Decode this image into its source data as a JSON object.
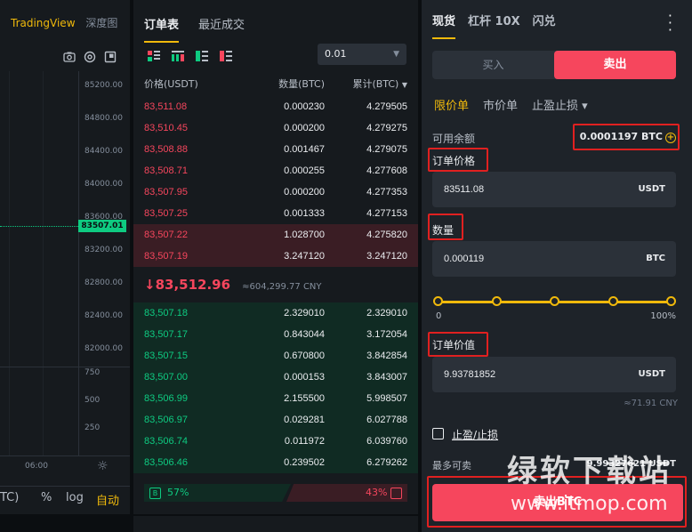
{
  "chart": {
    "tabs": [
      "TradingView",
      "深度图"
    ],
    "price_ticks": [
      "85200.00",
      "84800.00",
      "84400.00",
      "84000.00",
      "83600.00",
      "83200.00",
      "82800.00",
      "82400.00",
      "82000.00"
    ],
    "current_price": "83507.01",
    "volume_ticks": [
      "750",
      "500",
      "250"
    ],
    "time_label": "06:00",
    "bottom": {
      "unit_fragment": "TC)",
      "percent": "%",
      "log": "log",
      "auto": "自动"
    }
  },
  "book": {
    "tabs": [
      "订单表",
      "最近成交"
    ],
    "precision": "0.01",
    "headers": {
      "price": "价格(USDT)",
      "amount": "数量(BTC)",
      "total": "累计(BTC)"
    },
    "asks": [
      {
        "price": "83,511.08",
        "amount": "0.000230",
        "total": "4.279505",
        "depth": 0.0
      },
      {
        "price": "83,510.45",
        "amount": "0.000200",
        "total": "4.279275",
        "depth": 0.0
      },
      {
        "price": "83,508.88",
        "amount": "0.001467",
        "total": "4.279075",
        "depth": 0.0
      },
      {
        "price": "83,508.71",
        "amount": "0.000255",
        "total": "4.277608",
        "depth": 0.0
      },
      {
        "price": "83,507.95",
        "amount": "0.000200",
        "total": "4.277353",
        "depth": 0.0
      },
      {
        "price": "83,507.25",
        "amount": "0.001333",
        "total": "4.277153",
        "depth": 0.0
      },
      {
        "price": "83,507.22",
        "amount": "1.028700",
        "total": "4.275820",
        "depth": 1.0
      },
      {
        "price": "83,507.19",
        "amount": "3.247120",
        "total": "3.247120",
        "depth": 1.0
      }
    ],
    "mid_price": "↓83,512.96",
    "mid_cny": "≈604,299.77 CNY",
    "bids": [
      {
        "price": "83,507.18",
        "amount": "2.329010",
        "total": "2.329010",
        "depth": 1.0
      },
      {
        "price": "83,507.17",
        "amount": "0.843044",
        "total": "3.172054",
        "depth": 1.0
      },
      {
        "price": "83,507.15",
        "amount": "0.670800",
        "total": "3.842854",
        "depth": 1.0
      },
      {
        "price": "83,507.00",
        "amount": "0.000153",
        "total": "3.843007",
        "depth": 1.0
      },
      {
        "price": "83,506.99",
        "amount": "2.155500",
        "total": "5.998507",
        "depth": 1.0
      },
      {
        "price": "83,506.97",
        "amount": "0.029281",
        "total": "6.027788",
        "depth": 1.0
      },
      {
        "price": "83,506.74",
        "amount": "0.011972",
        "total": "6.039760",
        "depth": 1.0
      },
      {
        "price": "83,506.46",
        "amount": "0.239502",
        "total": "6.279262",
        "depth": 1.0
      }
    ],
    "buy_ratio": "57%",
    "sell_ratio": "43%",
    "buy_badge": "B"
  },
  "trade": {
    "tabs": [
      "现货",
      "杠杆 10X",
      "闪兑"
    ],
    "buy_label": "买入",
    "sell_label": "卖出",
    "order_types": [
      "限价单",
      "市价单",
      "止盈止损 ▾"
    ],
    "available_label": "可用余额",
    "available_value": "0.0001197 BTC",
    "price_label": "订单价格",
    "price_value": "83511.08",
    "price_unit": "USDT",
    "amount_label": "数量",
    "amount_value": "0.000119",
    "amount_unit": "BTC",
    "slider_min": "0",
    "slider_max": "100%",
    "slider_fraction": 1.0,
    "value_label": "订单价值",
    "value_value": "9.93781852",
    "value_unit": "USDT",
    "value_cny": "≈71.91 CNY",
    "tpsl_label": "止盈/止损",
    "max_label": "最多可卖",
    "max_value": "9.99327621 USDT",
    "submit_label": "卖出BTC"
  },
  "watermark": {
    "cn": "绿软下载站",
    "url": "www.itmop.com"
  },
  "colors": {
    "accent": "#f0b90b",
    "sell": "#f6465d",
    "buy": "#0ecb81",
    "highlight": "#e02020"
  }
}
